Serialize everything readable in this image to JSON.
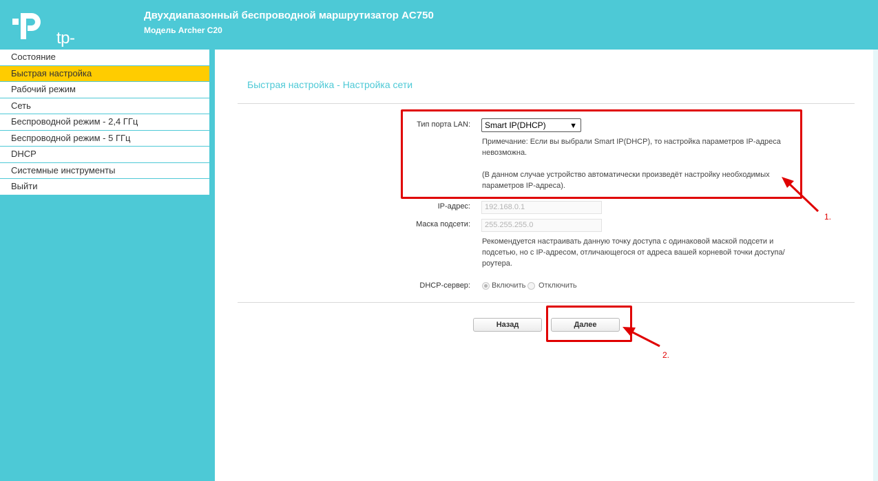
{
  "header": {
    "logo_text": "tp-link",
    "title": "Двухдиапазонный беспроводной маршрутизатор AC750",
    "model": "Модель Archer C20",
    "color": "#4dc9d6"
  },
  "sidebar": {
    "items": [
      {
        "label": "Состояние"
      },
      {
        "label": "Быстрая настройка"
      },
      {
        "label": "Рабочий режим"
      },
      {
        "label": "Сеть"
      },
      {
        "label": "Беспроводной режим - 2,4 ГГц"
      },
      {
        "label": "Беспроводной режим - 5 ГГц"
      },
      {
        "label": "DHCP"
      },
      {
        "label": "Системные инструменты"
      },
      {
        "label": "Выйти"
      }
    ],
    "active_index": 1,
    "active_color": "#ffcc00"
  },
  "main": {
    "title": "Быстрая настройка - Настройка сети",
    "lan_port": {
      "label": "Тип порта LAN:",
      "value": "Smart IP(DHCP)",
      "note1": "Примечание: Если вы выбрали Smart IP(DHCP), то настройка параметров IP-адреса невозможна.",
      "note2": "(В данном случае устройство автоматически произведёт настройку необходимых параметров IP-адреса)."
    },
    "ip": {
      "label": "IP-адрес:",
      "value": "192.168.0.1"
    },
    "mask": {
      "label": "Маска подсети:",
      "value": "255.255.255.0"
    },
    "recommendation": "Рекомендуется настраивать данную точку доступа с одинаковой маской подсети и подсетью, но с IP-адресом, отличающегося от адреса вашей корневой точки доступа/роутера.",
    "dhcp": {
      "label": "DHCP-сервер:",
      "option_on": "Включить",
      "option_off": "Отключить",
      "selected": "Включить"
    },
    "buttons": {
      "back": "Назад",
      "next": "Далее"
    }
  },
  "annotations": {
    "label1": "1.",
    "label2": "2.",
    "color": "#e00000"
  }
}
